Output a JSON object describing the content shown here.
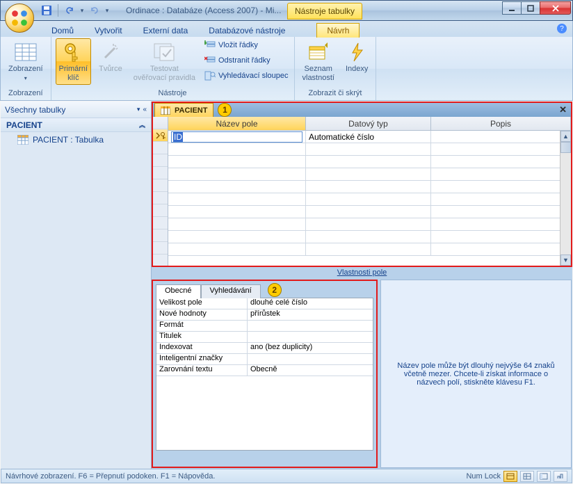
{
  "title": "Ordinace : Databáze (Access 2007) - Mi...",
  "toolContext": "Nástroje tabulky",
  "winControls": {
    "min": "▁",
    "max": "▢",
    "close": "X"
  },
  "tabs": [
    "Domů",
    "Vytvořit",
    "Externí data",
    "Databázové nástroje"
  ],
  "contextTab": "Návrh",
  "ribbon": {
    "groups": {
      "zobrazeni": {
        "label": "Zobrazení",
        "btn": "Zobrazení"
      },
      "nastroje": {
        "label": "Nástroje",
        "pk": "Primární\nklíč",
        "builder": "Tvůrce",
        "test": "Testovat\nověřovací pravidla",
        "insertRows": "Vložit řádky",
        "deleteRows": "Odstranit řádky",
        "lookupCol": "Vyhledávací sloupec"
      },
      "zobrazitSkryt": {
        "label": "Zobrazit či skrýt",
        "propSheet": "Seznam\nvlastností",
        "indexes": "Indexy"
      }
    }
  },
  "navPane": {
    "header": "Všechny tabulky",
    "group": "PACIENT",
    "item": "PACIENT : Tabulka"
  },
  "docTab": "PACIENT",
  "annot1": "1",
  "annot2": "2",
  "designGrid": {
    "headers": {
      "name": "Název pole",
      "type": "Datový typ",
      "desc": "Popis"
    },
    "row1": {
      "name": "ID",
      "type": "Automatické číslo",
      "desc": ""
    }
  },
  "fieldPropsTitle": "Vlastnosti pole",
  "fpTabs": {
    "general": "Obecné",
    "lookup": "Vyhledávání"
  },
  "fpRows": [
    {
      "k": "Velikost pole",
      "v": "dlouhé celé číslo"
    },
    {
      "k": "Nové hodnoty",
      "v": "přírůstek"
    },
    {
      "k": "Formát",
      "v": ""
    },
    {
      "k": "Titulek",
      "v": ""
    },
    {
      "k": "Indexovat",
      "v": "ano (bez duplicity)"
    },
    {
      "k": "Inteligentní značky",
      "v": ""
    },
    {
      "k": "Zarovnání textu",
      "v": "Obecně"
    }
  ],
  "helpText": "Název pole může být dlouhý nejvýše 64 znaků včetně mezer. Chcete-li získat informace o názvech polí, stiskněte klávesu F1.",
  "status": {
    "left": "Návrhové zobrazení.  F6 = Přepnutí podoken.    F1 = Nápověda.",
    "numlock": "Num Lock"
  }
}
